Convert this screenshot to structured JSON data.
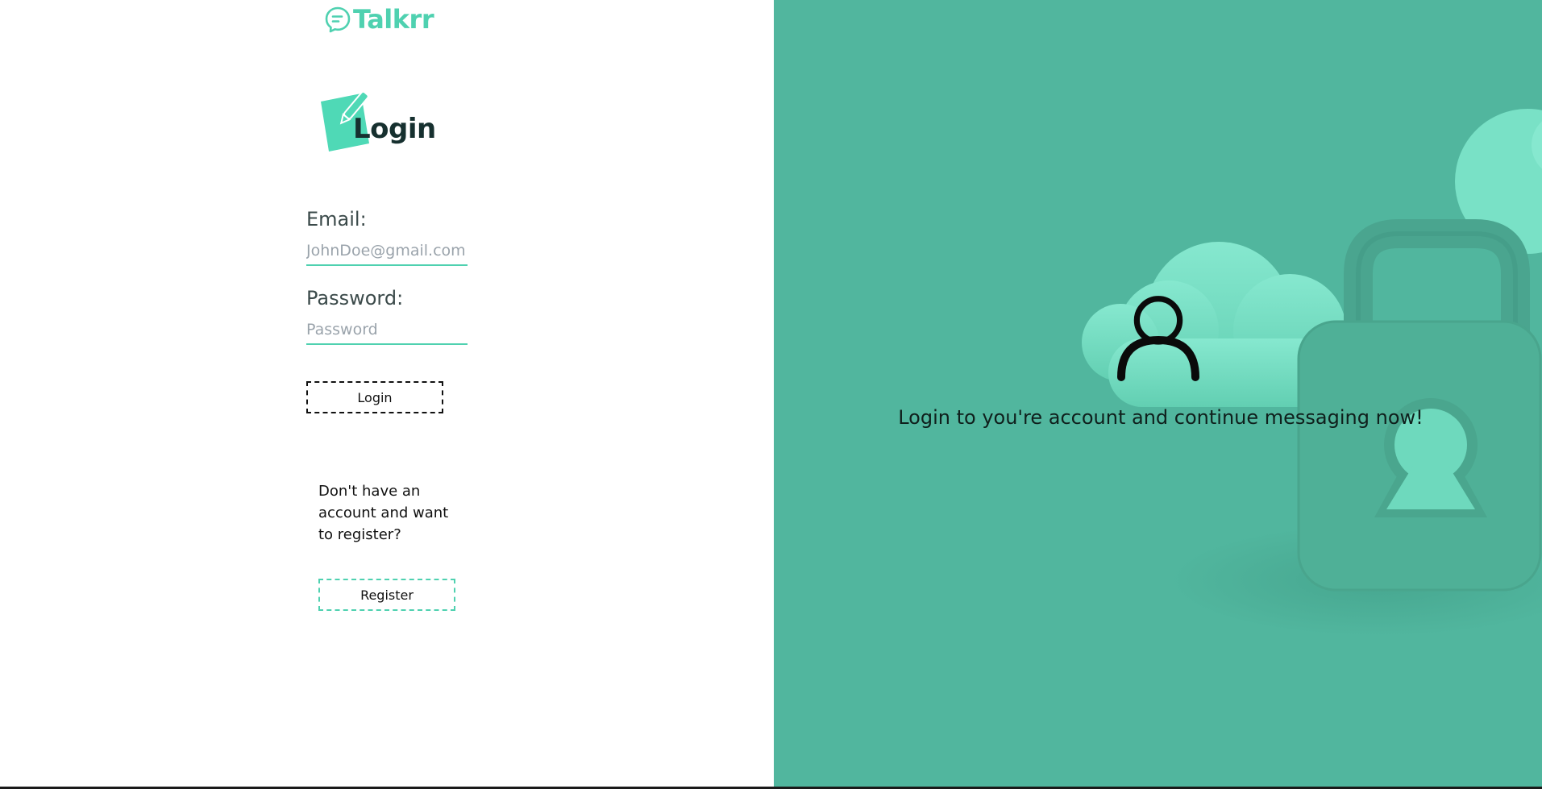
{
  "brand": {
    "name": "Talkrr",
    "icon": "chat-bubble-icon",
    "color": "#4fd1b0"
  },
  "login_form": {
    "title": "Login",
    "title_icon": "note-pencil-icon",
    "email": {
      "label": "Email:",
      "value": "",
      "placeholder": "JohnDoe@gmail.com"
    },
    "password": {
      "label": "Password:",
      "value": "",
      "placeholder": "Password"
    },
    "login_button_label": "Login"
  },
  "register": {
    "prompt": "Don't have an account and want to register?",
    "button_label": "Register"
  },
  "hero": {
    "icon": "user-icon",
    "tagline": "Login to you're account and continue messaging now!",
    "background_color": "#51b69e",
    "illustration": "cloud-and-padlock"
  }
}
